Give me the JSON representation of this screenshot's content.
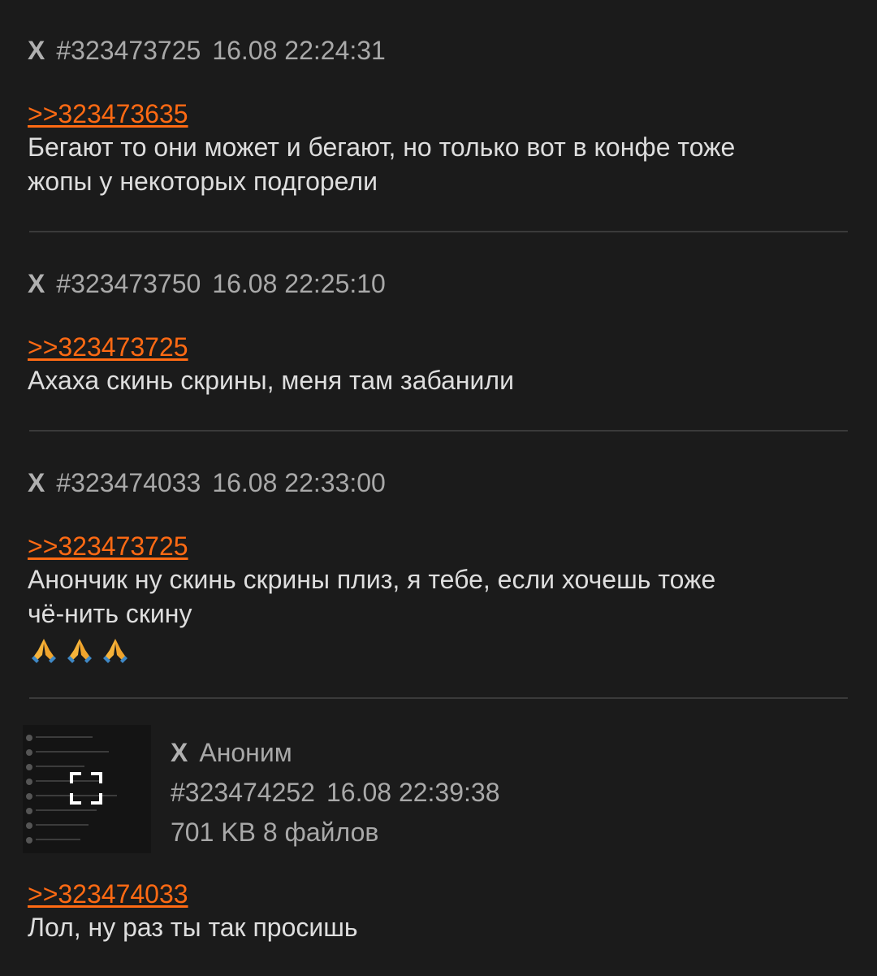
{
  "posts": [
    {
      "marker": "X",
      "number": "#323473725",
      "datetime": "16.08 22:24:31",
      "reply_to": ">>323473635",
      "lines": [
        "Бегают то они может и бегают, но только вот в конфе тоже",
        "жопы у некоторых подгорели"
      ]
    },
    {
      "marker": "X",
      "number": "#323473750",
      "datetime": "16.08 22:25:10",
      "reply_to": ">>323473725",
      "lines": [
        "Ахаха скинь скрины, меня там забанили"
      ]
    },
    {
      "marker": "X",
      "number": "#323474033",
      "datetime": "16.08 22:33:00",
      "reply_to": ">>323473725",
      "lines": [
        "Анончик ну скинь скрины плиз, я тебе, если хочешь тоже",
        "чё-нить скину"
      ],
      "emojis": [
        "folded-hands-icon",
        "folded-hands-icon",
        "folded-hands-icon"
      ]
    },
    {
      "marker": "X",
      "author": "Аноним",
      "number": "#323474252",
      "datetime": "16.08 22:39:38",
      "attachments": "701 KB 8 файлов",
      "reply_to": ">>323474033",
      "lines": [
        "Лол, ну раз ты так просишь"
      ]
    }
  ],
  "colors": {
    "background": "#1b1b1b",
    "link": "#ff6a13",
    "meta": "#a9a9a9",
    "text": "#dedede",
    "divider": "#3a3a3a"
  }
}
